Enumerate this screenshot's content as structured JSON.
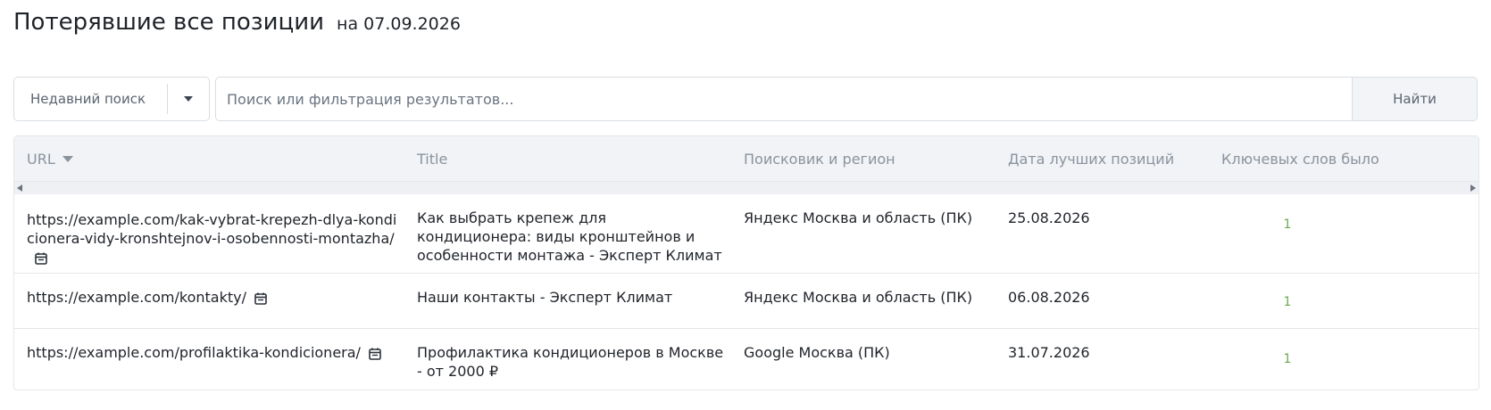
{
  "header": {
    "title": "Потерявшие все позиции",
    "date": "на 07.09.2026"
  },
  "search": {
    "recent_label": "Недавний поиск",
    "placeholder": "Поиск или фильтрация результатов...",
    "value": "",
    "find_label": "Найти"
  },
  "table": {
    "columns": {
      "url": "URL",
      "title": "Title",
      "engine": "Поисковик и регион",
      "best_date": "Дата лучших позиций",
      "keywords": "Ключевых слов было"
    },
    "rows": [
      {
        "url": "https://example.com/kak-vybrat-krepezh-dlya-kondicionera-vidy-kronshtejnov-i-osobennosti-montazha/",
        "title": "Как выбрать крепеж для кондиционера: виды кронштейнов и особенности монтажа - Эксперт Климат",
        "engine": "Яндекс Москва и область (ПК)",
        "best_date": "25.08.2026",
        "keywords": "1"
      },
      {
        "url": "https://example.com/kontakty/",
        "title": "Наши контакты - Эксперт Климат",
        "engine": "Яндекс Москва и область (ПК)",
        "best_date": "06.08.2026",
        "keywords": "1"
      },
      {
        "url": "https://example.com/profilaktika-kondicionera/",
        "title": "Профилактика кондиционеров в Москве - от 2000 ₽",
        "engine": "Google Москва (ПК)",
        "best_date": "31.07.2026",
        "keywords": "1"
      }
    ]
  },
  "icons": {
    "sort": "caret-down-icon",
    "calendar": "calendar-icon"
  },
  "colors": {
    "keyword_count": "#6aa84f",
    "header_bg": "#f1f3f6",
    "header_text": "#8a939e"
  }
}
